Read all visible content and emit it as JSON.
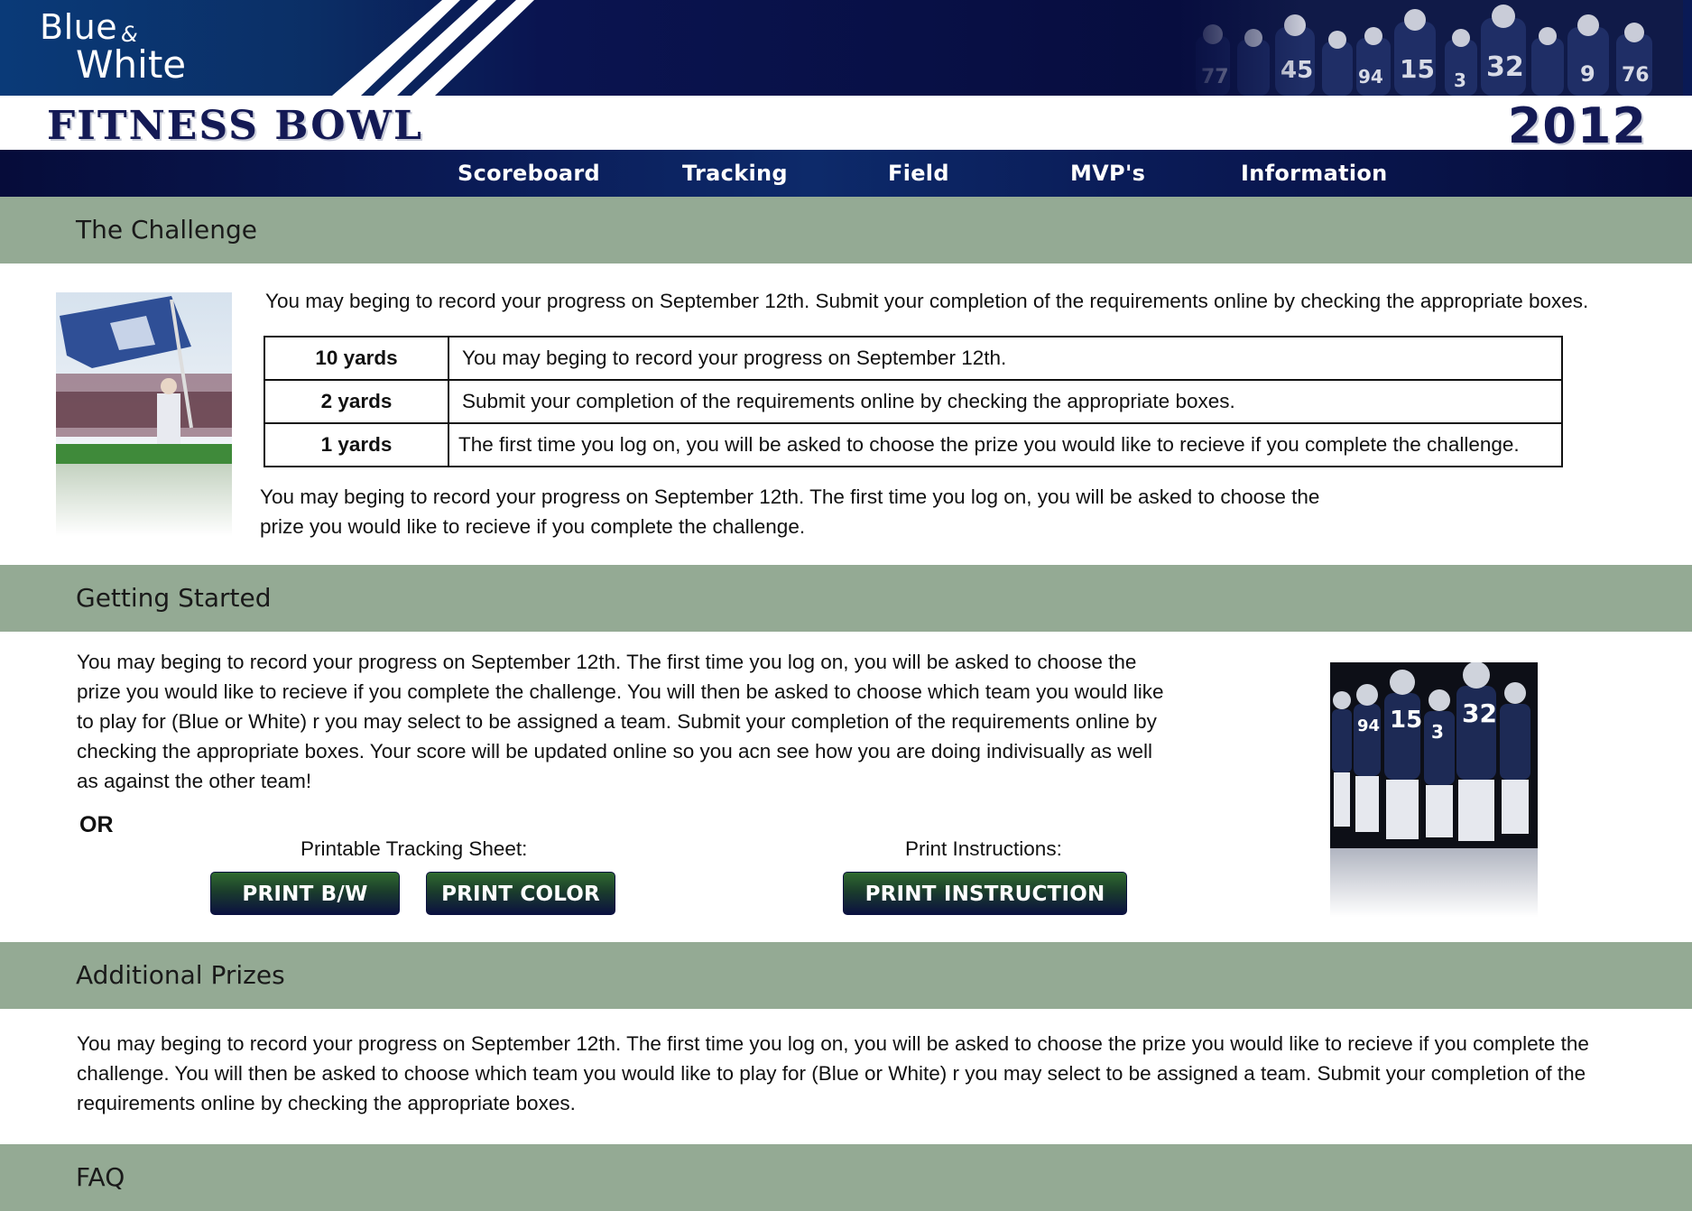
{
  "header": {
    "logo_line1": "Blue",
    "logo_amp": "&",
    "logo_line2": "White",
    "title": "FITNESS BOWL",
    "year": "2012"
  },
  "nav": {
    "items": [
      "Scoreboard",
      "Tracking",
      "Field",
      "MVP's",
      "Information"
    ]
  },
  "challenge": {
    "heading": "The Challenge",
    "intro": "You may beging to record your progress on September 12th.  Submit your completion of the requirements online by checking the appropriate boxes.",
    "rows": [
      {
        "yards": "10 yards",
        "text": "You may beging to record your progress on September 12th."
      },
      {
        "yards": "2 yards",
        "text": "Submit your completion of the requirements online by checking the appropriate boxes."
      },
      {
        "yards": "1 yards",
        "text": "The first time you log on, you will be asked to choose the prize you would like to recieve if you complete the challenge."
      }
    ],
    "outro_line1": "You may beging to record your progress on September 12th. The first time you log on, you will be asked to choose the",
    "outro_line2": "prize you would like to recieve if you complete the challenge."
  },
  "getting_started": {
    "heading": "Getting Started",
    "lines": [
      "You may beging to record your progress on September 12th. The first time you log on, you will be asked to choose the",
      "prize you would like to recieve if you complete the challenge. You will then be asked to choose which team you would like",
      "to play for (Blue or White) r you may select to be assigned a team. Submit your completion of the requirements online by",
      "checking the appropriate boxes. Your score will be updated online so you acn see how you are doing indivisually as well",
      "as against the other team!"
    ],
    "or_label": "OR",
    "tracking_label": "Printable Tracking Sheet:",
    "instructions_label": "Print Instructions:",
    "btn_bw": "PRINT B/W",
    "btn_color": "PRINT COLOR",
    "btn_instruction": "PRINT INSTRUCTION"
  },
  "additional_prizes": {
    "heading": "Additional Prizes",
    "lines": [
      "You may beging to record your progress on September 12th. The first time you log on, you will be asked to choose the prize you would like to recieve if you complete the",
      "challenge. You will then be asked to choose which team you would like to play for (Blue or White) r you may select to be assigned a team. Submit your completion of the",
      "requirements online by checking the appropriate boxes."
    ]
  },
  "faq": {
    "heading": "FAQ"
  },
  "colors": {
    "navy": "#0a1450",
    "section_green": "#94aa94",
    "button_green": "#2f6a2f"
  }
}
